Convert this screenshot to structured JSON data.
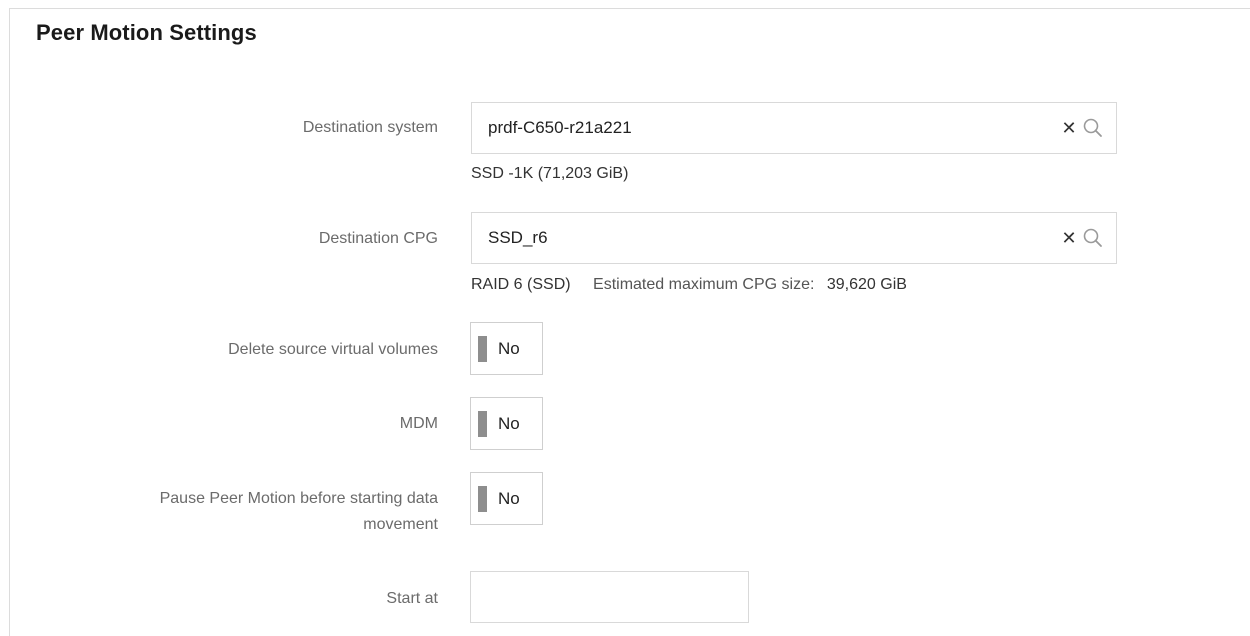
{
  "section": {
    "title": "Peer Motion Settings"
  },
  "destination_system": {
    "label": "Destination system",
    "value": "prdf-C650-r21a221",
    "info": "SSD -1K (71,203 GiB)"
  },
  "destination_cpg": {
    "label": "Destination CPG",
    "value": "SSD_r6",
    "raid": "RAID 6 (SSD)",
    "estimate_label": "Estimated maximum CPG size:",
    "estimate_value": "39,620 GiB"
  },
  "delete_source": {
    "label": "Delete source virtual volumes",
    "state": "No"
  },
  "mdm": {
    "label": "MDM",
    "state": "No"
  },
  "pause_peer_motion": {
    "label_line1": "Pause Peer Motion before starting data",
    "label_line2": "movement",
    "state": "No"
  },
  "start_at": {
    "label": "Start at",
    "value": ""
  },
  "icons": {
    "clear": "close-icon",
    "search": "search-icon"
  }
}
